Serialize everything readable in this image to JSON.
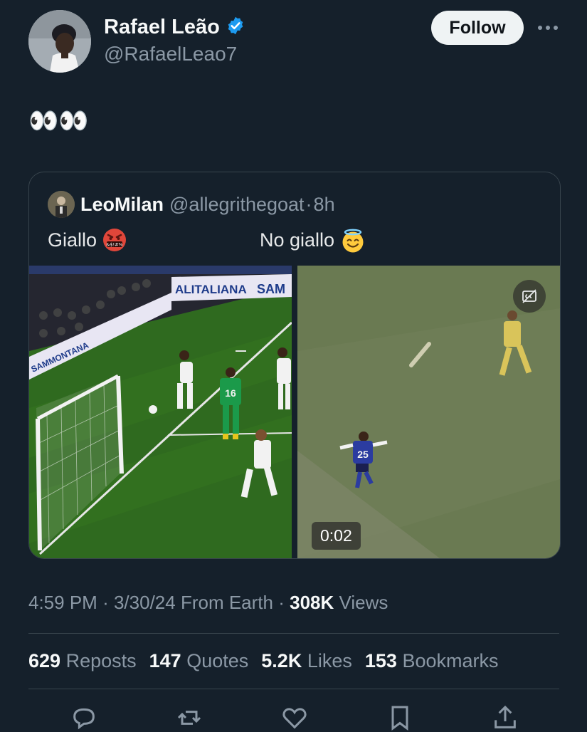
{
  "author": {
    "name": "Rafael Leão",
    "handle": "@RafaelLeao7",
    "verified_icon": "verified-badge-icon",
    "follow_label": "Follow",
    "more_icon": "more-icon"
  },
  "tweet": {
    "text": "👀👀"
  },
  "quote": {
    "name": "LeoMilan",
    "handle": "@allegrithegoat",
    "sep": "·",
    "time": "8h",
    "left_caption": "Giallo",
    "right_caption": "No giallo",
    "media_left_sign_1": "ALITALIANA",
    "media_left_sign_2": "SAM",
    "media_left_sign_3": "SAMMONTANA",
    "player_number": "16",
    "video_player_number": "25",
    "duration": "0:02",
    "cc_icon": "captions-off-icon"
  },
  "meta": {
    "time": "4:59 PM",
    "sep1": "·",
    "date": "3/30/24",
    "source": "From Earth",
    "sep2": "·",
    "views_count": "308K",
    "views_label": "Views"
  },
  "stats": [
    {
      "count": "629",
      "label": "Reposts"
    },
    {
      "count": "147",
      "label": "Quotes"
    },
    {
      "count": "5.2K",
      "label": "Likes"
    },
    {
      "count": "153",
      "label": "Bookmarks"
    }
  ],
  "actions": [
    "reply-icon",
    "repost-icon",
    "like-icon",
    "bookmark-icon",
    "share-icon"
  ],
  "colors": {
    "background": "#15202b",
    "verified": "#1d9bf0",
    "muted": "#8b98a5",
    "border": "#38444d"
  }
}
